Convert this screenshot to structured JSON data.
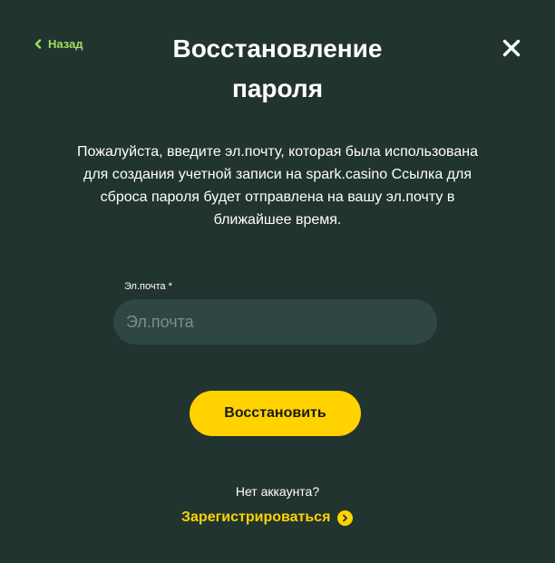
{
  "header": {
    "back_label": "Назад",
    "title_line1": "Восстановление",
    "title_line2": "пароля"
  },
  "description": "Пожалуйста, введите эл.почту, которая была использована для создания учетной записи на spark.casino Ссылка для сброса пароля будет отправлена на вашу эл.почту в ближайшее время.",
  "form": {
    "email_label": "Эл.почта *",
    "email_placeholder": "Эл.почта",
    "email_value": "",
    "submit_label": "Восстановить"
  },
  "footer": {
    "no_account_text": "Нет аккаунта?",
    "register_label": "Зарегистрироваться"
  },
  "colors": {
    "background": "#223430",
    "accent_yellow": "#ffd200",
    "accent_green": "#9be15d",
    "input_background": "#2e4742"
  },
  "icons": {
    "back": "chevron-left-icon",
    "close": "close-icon",
    "register": "chevron-right-circle-icon"
  }
}
